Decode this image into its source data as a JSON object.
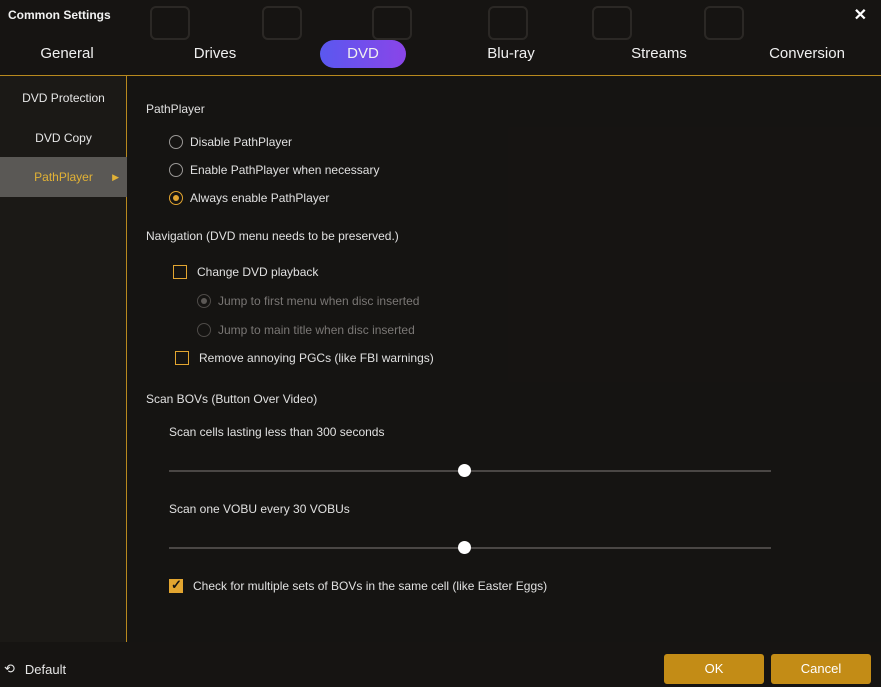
{
  "window": {
    "title": "Common Settings",
    "close_glyph": "✕"
  },
  "tabs": [
    {
      "label": "General",
      "active": false
    },
    {
      "label": "Drives",
      "active": false
    },
    {
      "label": "DVD",
      "active": true
    },
    {
      "label": "Blu-ray",
      "active": false
    },
    {
      "label": "Streams",
      "active": false
    },
    {
      "label": "Conversion",
      "active": false
    }
  ],
  "sidebar": {
    "items": [
      {
        "label": "DVD Protection",
        "active": false
      },
      {
        "label": "DVD Copy",
        "active": false
      },
      {
        "label": "PathPlayer",
        "active": true
      }
    ],
    "arrow_glyph": "▶"
  },
  "pathplayer": {
    "heading": "PathPlayer",
    "options": [
      {
        "label": "Disable PathPlayer",
        "checked": false
      },
      {
        "label": "Enable PathPlayer when necessary",
        "checked": false
      },
      {
        "label": "Always enable PathPlayer",
        "checked": true
      }
    ]
  },
  "navigation": {
    "heading": "Navigation (DVD menu needs to be preserved.)",
    "change_playback": {
      "label": "Change DVD playback",
      "checked": false
    },
    "sub_options": [
      {
        "label": "Jump to first menu when disc inserted",
        "checked": true,
        "disabled": true
      },
      {
        "label": "Jump to main title when disc inserted",
        "checked": false,
        "disabled": true
      }
    ],
    "remove_pgcs": {
      "label": "Remove annoying PGCs (like FBI warnings)",
      "checked": false
    }
  },
  "scan_bovs": {
    "heading": "Scan BOVs (Button Over Video)",
    "cells_label": "Scan cells lasting less than 300 seconds",
    "cells_slider_fraction": 0.49,
    "vobu_label": "Scan one VOBU every 30 VOBUs",
    "vobu_slider_fraction": 0.49,
    "easter_eggs": {
      "label": "Check for multiple sets of BOVs in the same cell (like Easter Eggs)",
      "checked": true
    }
  },
  "footer": {
    "default_label": "Default",
    "default_icon": "reset-icon",
    "ok_label": "OK",
    "cancel_label": "Cancel"
  },
  "colors": {
    "accent": "#e2a530",
    "button": "#c38c16",
    "tab_active_start": "#5a58ef",
    "tab_active_end": "#8a45e8",
    "divider": "#b8891e"
  }
}
